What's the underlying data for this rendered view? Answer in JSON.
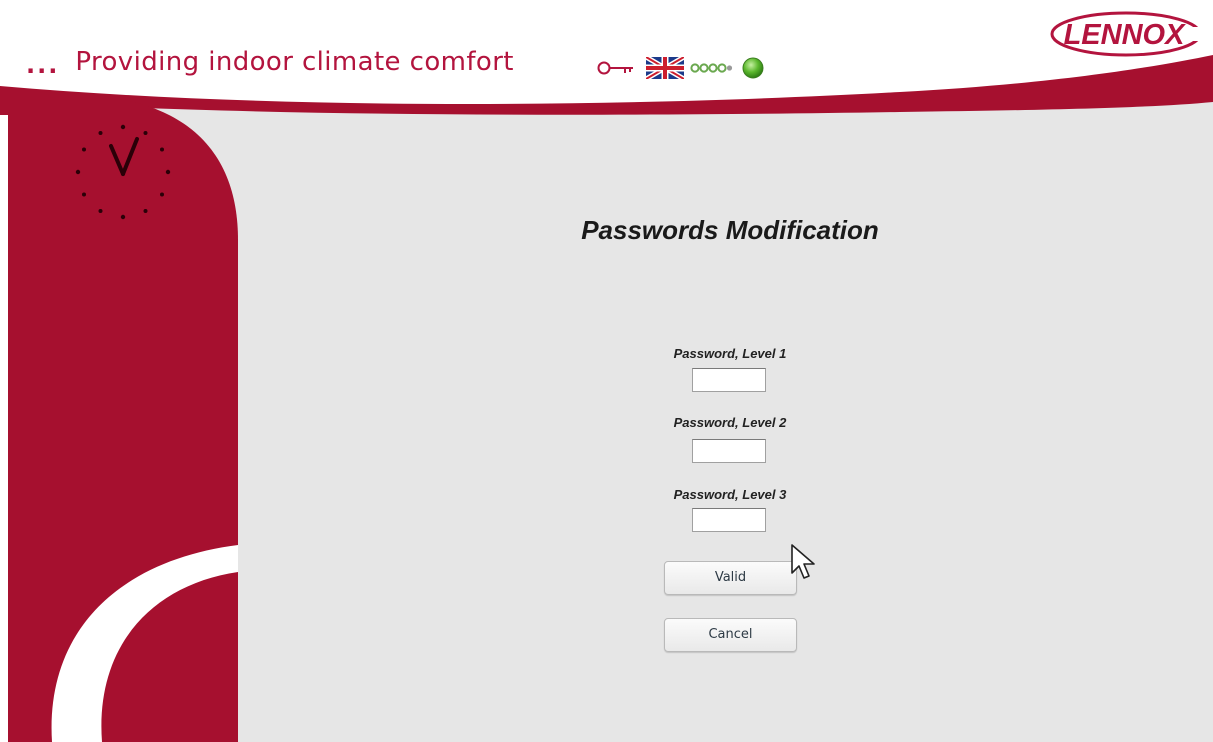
{
  "header": {
    "tagline_prefix": "...",
    "tagline": "Providing indoor climate comfort",
    "brand": "LENNOX"
  },
  "status_bar": {
    "icons": [
      "key-icon",
      "uk-flag-icon",
      "level-dots-icon",
      "status-led-icon"
    ],
    "level_dots_filled": 4,
    "level_dots_total": 4,
    "status_led_color": "#5cb82e"
  },
  "form": {
    "title": "Passwords Modification",
    "fields": [
      {
        "label": "Password, Level 1",
        "value": ""
      },
      {
        "label": "Password, Level 2",
        "value": ""
      },
      {
        "label": "Password, Level 3",
        "value": ""
      }
    ],
    "valid_label": "Valid",
    "cancel_label": "Cancel"
  },
  "colors": {
    "brand": "#b3143e",
    "panel": "#e6e6e6",
    "status_led": "#5cb82e"
  }
}
